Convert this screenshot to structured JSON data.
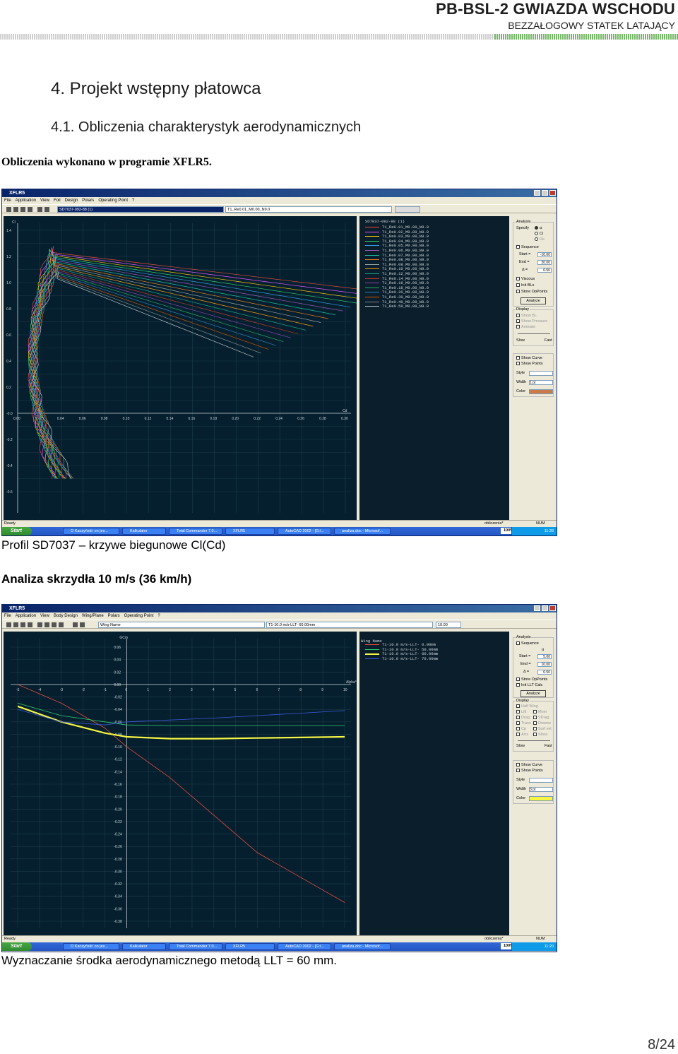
{
  "header": {
    "title": "PB-BSL-2 GWIAZDA WSCHODU",
    "subtitle": "BEZZAŁOGOWY STATEK LATAJĄCY"
  },
  "section": {
    "heading": "4. Projekt wstępny płatowca",
    "subheading": "4.1. Obliczenia charakterystyk aerodynamicznych",
    "intro": "Obliczenia wykonano w programie XFLR5."
  },
  "captions": {
    "polar": "Profil SD7037 – krzywe biegunowe Cl(Cd)",
    "wing_heading": "Analiza skrzydła 10 m/s (36 km/h)",
    "llt": "Wyznaczanie środka aerodynamicznego metodą LLT = 60 mm."
  },
  "page": "8/24",
  "win1": {
    "title": "XFLR5",
    "menu": [
      "File",
      "Application",
      "View",
      "Foil",
      "Design",
      "Polars",
      "Operating Point",
      "?"
    ],
    "combo_foil": "SD7037-092-88 (1)",
    "combo_polar": "T1_Re0.01_M0.00_N9.0",
    "legend_title": "SD7037-092-88 (1)",
    "legend": [
      "T1_Re0.01_M0.00_N9.0",
      "T1_Re0.02_M0.00_N9.0",
      "T1_Re0.03_M0.00_N9.0",
      "T1_Re0.04_M0.00_N9.0",
      "T1_Re0.05_M0.00_N9.0",
      "T1_Re0.06_M0.00_N9.0",
      "T1_Re0.07_M0.00_N9.0",
      "T1_Re0.08_M0.00_N9.0",
      "T1_Re0.09_M0.00_N9.0",
      "T1_Re0.10_M0.00_N9.0",
      "T1_Re0.12_M0.00_N9.0",
      "T1_Re0.14_M0.00_N9.0",
      "T1_Re0.16_M0.00_N9.0",
      "T1_Re0.18_M0.00_N9.0",
      "T1_Re0.20_M0.00_N9.0",
      "T1_Re0.30_M0.00_N9.0",
      "T1_Re0.40_M0.00_N9.0",
      "T1_Re0.50_M0.00_N9.0"
    ],
    "legend_colors": [
      "#e74c3c",
      "#e056fd",
      "#f1c40f",
      "#2ecc71",
      "#3498db",
      "#9b59b6",
      "#1abc9c",
      "#e67e22",
      "#95a5a6",
      "#f39c12",
      "#16a085",
      "#c0392b",
      "#8e44ad",
      "#27ae60",
      "#2980b9",
      "#d35400",
      "#7f8c8d",
      "#bdc3c7"
    ],
    "ylabel": "Cl",
    "xlabel": "Cd",
    "yticks": [
      "1.4",
      "1.2",
      "1.0",
      "0.8",
      "0.6",
      "0.4",
      "0.2",
      "-0.0",
      "-0.2",
      "-0.4",
      "-0.6"
    ],
    "xticks": [
      "0.00",
      "0.02",
      "0.04",
      "0.06",
      "0.08",
      "0.10",
      "0.12",
      "0.14",
      "0.16",
      "0.18",
      "0.20",
      "0.22",
      "0.24",
      "0.26",
      "0.28",
      "0.30"
    ],
    "side": {
      "analysis": "Analysis",
      "specify": "Specify",
      "alpha": "α",
      "cl": "Cl",
      "re": "Re",
      "sequence": "Sequence",
      "start_l": "Start =",
      "start_v": "-10.00",
      "end_l": "End =",
      "end_v": "20.00",
      "delta_l": "Δ =",
      "delta_v": "0.50",
      "viscous": "Viscous",
      "initbl": "Init BLs",
      "store": "Store OpPoints",
      "analyze": "Analyze",
      "display": "Display",
      "showbl": "Show BL",
      "showp": "Show Pressure",
      "animate": "Animate",
      "slow": "Slow",
      "fast": "Fast",
      "showcurve": "Show Curve",
      "showpoints": "Show Points",
      "style": "Style",
      "width": "Width",
      "width_v": "1 pt",
      "color": "Color",
      "color_hex": "#c97b4a"
    },
    "status": "Ready",
    "status_file": "obliczenia*",
    "status_num": "NUM",
    "tasks": [
      "O Kaczyński: on jes...",
      "Kalkulator",
      "Total Commander 7.0...",
      "XFLR5",
      "AutoCAD 2002 - [G:/...",
      "analiza.doc - Microsof..."
    ],
    "start": "Start",
    "zoom": "100%",
    "clock": "11:28"
  },
  "win2": {
    "title": "XFLR5",
    "menu": [
      "File",
      "Application",
      "View",
      "Body Design",
      "Wing/Plane",
      "Polars",
      "Operating Point",
      "?"
    ],
    "combo_wing": "Wing Name",
    "combo_polar": "T1-10.0 m/s-LLT- 60.00mm",
    "combo_val": "10.00",
    "legend_title": "Wing Name",
    "legend": [
      "T1-10.0 m/s-LLT-  0.00mm",
      "T1-10.0 m/s-LLT- 50.00mm",
      "T1-10.0 m/s-LLT- 60.00mm",
      "T1-10.0 m/s-LLT- 70.00mm"
    ],
    "legend_colors": [
      "#e74c3c",
      "#2ecc71",
      "#f5f542",
      "#3b5bdb"
    ],
    "ylabel": "GCm",
    "xlabel": "Alpha°",
    "yticks": [
      "0.06",
      "0.04",
      "0.02",
      "0.00",
      "-0.02",
      "-0.04",
      "-0.06",
      "-0.08",
      "-0.10",
      "-0.12",
      "-0.14",
      "-0.16",
      "-0.18",
      "-0.20",
      "-0.22",
      "-0.24",
      "-0.26",
      "-0.28",
      "-0.30",
      "-0.32",
      "-0.34",
      "-0.36",
      "-0.38"
    ],
    "xticks": [
      "-5",
      "-4",
      "-3",
      "-2",
      "-1",
      "0",
      "1",
      "2",
      "3",
      "4",
      "5",
      "6",
      "7",
      "8",
      "9",
      "10"
    ],
    "side": {
      "analysis": "Analysis",
      "sequence": "Sequence",
      "alpha": "α",
      "start_l": "Start =",
      "start_v": "5.00",
      "end_l": "End =",
      "end_v": "10.00",
      "delta_l": "Δ =",
      "delta_v": "0.50",
      "store": "Store OpPoints",
      "initllt": "Init LLT Calc",
      "analyze": "Analyze",
      "display": "Display",
      "halfwing": "Half Wing",
      "lift": "Lift",
      "moment": "Mom",
      "drag": "Drag",
      "vdrag": "VDrag",
      "trans": "Trans",
      "downw": "Downw",
      "cp": "Cp",
      "surfvel": "Surf vel",
      "arrows": "Arrs",
      "stream": "Strea",
      "slow": "Slow",
      "fast": "Fast",
      "showcurve": "Show Curve",
      "showpoints": "Show Points",
      "style": "Style",
      "width": "Width",
      "width_v": "3 pt",
      "color": "Color",
      "color_hex": "#f5f542"
    },
    "status": "Ready",
    "status_file": "obliczenia*",
    "status_num": "NUM",
    "tasks": [
      "O Kaczyński: on jes...",
      "Kalkulator",
      "Total Commander 7.0...",
      "XFLR5",
      "AutoCAD 2002 - [G:/...",
      "analiza.doc - Microsof..."
    ],
    "start": "Start",
    "zoom": "100%",
    "clock": "11:20"
  },
  "chart_data": [
    {
      "type": "line",
      "title": "",
      "xlabel": "Cd",
      "ylabel": "Cl",
      "xlim": [
        0,
        0.3
      ],
      "ylim": [
        -0.6,
        1.5
      ],
      "series_count": 18
    },
    {
      "type": "line",
      "title": "",
      "xlabel": "Alpha°",
      "ylabel": "GCm",
      "xlim": [
        -5,
        10
      ],
      "ylim": [
        -0.38,
        0.07
      ],
      "series": [
        {
          "name": "T1-10.0 m/s-LLT-  0.00mm",
          "x": [
            -5,
            -3,
            -1,
            0,
            2,
            4,
            6,
            8,
            10
          ],
          "values": [
            0.0,
            -0.03,
            -0.07,
            -0.1,
            -0.15,
            -0.21,
            -0.27,
            -0.31,
            -0.35
          ]
        },
        {
          "name": "T1-10.0 m/s-LLT- 50.00mm",
          "x": [
            -5,
            -3,
            -1,
            0,
            2,
            4,
            6,
            8,
            10
          ],
          "values": [
            -0.03,
            -0.05,
            -0.06,
            -0.065,
            -0.066,
            -0.066,
            -0.066,
            -0.066,
            -0.066
          ]
        },
        {
          "name": "T1-10.0 m/s-LLT- 60.00mm",
          "x": [
            -5,
            -3,
            -1,
            0,
            2,
            4,
            6,
            8,
            10
          ],
          "values": [
            -0.035,
            -0.06,
            -0.078,
            -0.084,
            -0.087,
            -0.087,
            -0.086,
            -0.085,
            -0.084
          ]
        },
        {
          "name": "T1-10.0 m/s-LLT- 70.00mm",
          "x": [
            -5,
            -3,
            -1,
            0,
            2,
            4,
            6,
            8,
            10
          ],
          "values": [
            -0.04,
            -0.06,
            -0.065,
            -0.06,
            -0.057,
            -0.054,
            -0.05,
            -0.046,
            -0.042
          ]
        }
      ]
    }
  ]
}
